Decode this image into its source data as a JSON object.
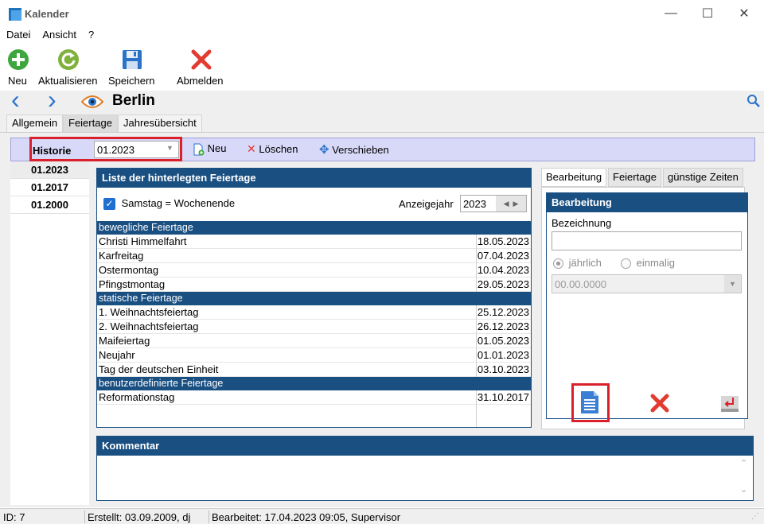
{
  "window": {
    "title": "Kalender",
    "minimize_glyph": "—",
    "maximize_glyph": "☐",
    "close_glyph": "✕"
  },
  "menu": [
    "Datei",
    "Ansicht",
    "?"
  ],
  "toolbar": {
    "new": "Neu",
    "refresh": "Aktualisieren",
    "save": "Speichern",
    "logout": "Abmelden"
  },
  "nav": {
    "back": "‹",
    "forward": "›",
    "location": "Berlin"
  },
  "tabs": [
    "Allgemein",
    "Feiertage",
    "Jahresübersicht"
  ],
  "history": {
    "label": "Historie",
    "selected": "01.2023",
    "items": [
      "01.2023",
      "01.2017",
      "01.2000"
    ],
    "actions": {
      "new": "Neu",
      "delete": "Löschen",
      "move": "Verschieben"
    }
  },
  "holiday_list": {
    "title": "Liste der hinterlegten Feiertage",
    "weekend_checkbox": "Samstag = Wochenende",
    "year_label": "Anzeigejahr",
    "year_value": "2023",
    "groups": [
      {
        "name": "bewegliche Feiertage",
        "items": [
          {
            "name": "Christi Himmelfahrt",
            "date": "18.05.2023"
          },
          {
            "name": "Karfreitag",
            "date": "07.04.2023"
          },
          {
            "name": "Ostermontag",
            "date": "10.04.2023"
          },
          {
            "name": "Pfingstmontag",
            "date": "29.05.2023"
          }
        ]
      },
      {
        "name": "statische Feiertage",
        "items": [
          {
            "name": "1. Weihnachtsfeiertag",
            "date": "25.12.2023"
          },
          {
            "name": "2. Weihnachtsfeiertag",
            "date": "26.12.2023"
          },
          {
            "name": "Maifeiertag",
            "date": "01.05.2023"
          },
          {
            "name": "Neujahr",
            "date": "01.01.2023"
          },
          {
            "name": "Tag der deutschen Einheit",
            "date": "03.10.2023"
          }
        ]
      },
      {
        "name": "benutzerdefinierte Feiertage",
        "items": [
          {
            "name": "Reformationstag",
            "date": "31.10.2017"
          }
        ]
      }
    ]
  },
  "edit_tabs": [
    "Bearbeitung",
    "Feiertage",
    "günstige Zeiten"
  ],
  "edit_panel": {
    "title": "Bearbeitung",
    "name_label": "Bezeichnung",
    "name_value": "",
    "option_yearly": "jährlich",
    "option_once": "einmalig",
    "date_value": "00.00.0000"
  },
  "comment": {
    "title": "Kommentar"
  },
  "status": {
    "id": "ID: 7",
    "created": "Erstellt: 03.09.2009, dj",
    "edited": "Bearbeitet: 17.04.2023 09:05, Supervisor"
  },
  "colors": {
    "panel_header": "#1a4f82",
    "highlight": "#d9202b",
    "history_bar": "#d8d8f8",
    "accent_blue": "#2a73c9"
  }
}
